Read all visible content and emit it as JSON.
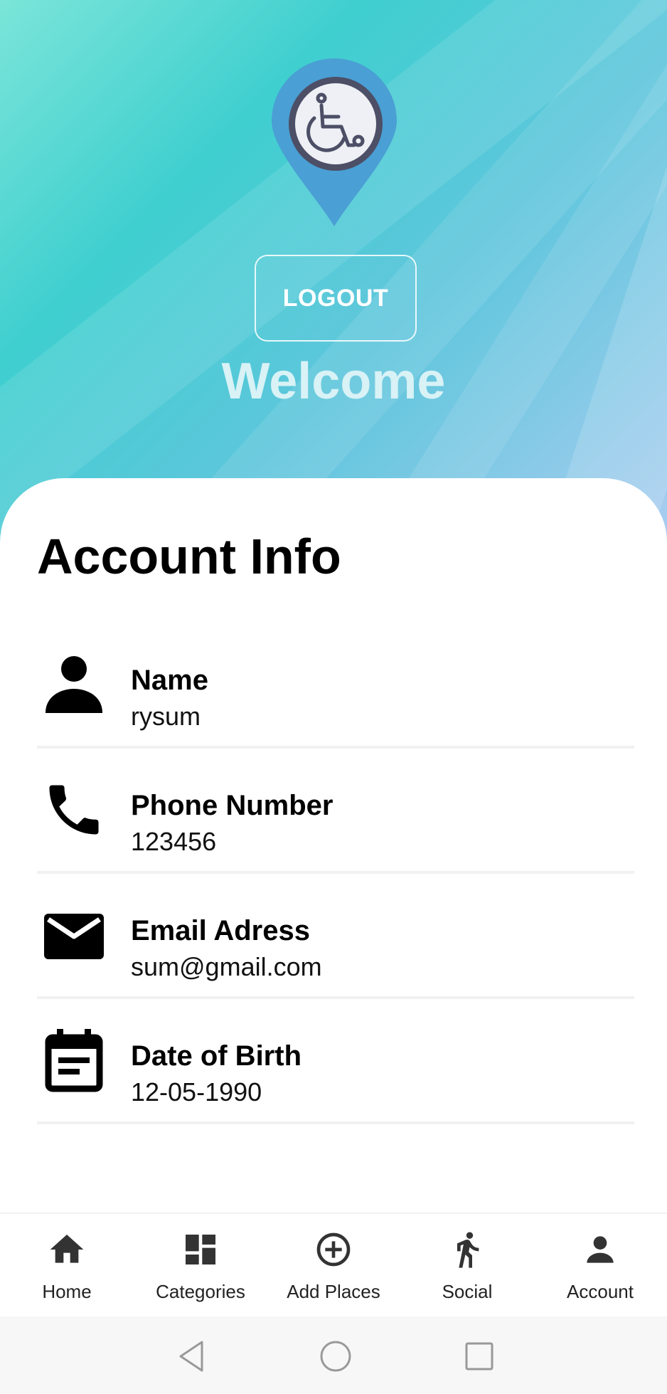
{
  "header": {
    "logout_label": "LOGOUT",
    "welcome_text": "Welcome",
    "logo_icon": "wheelchair-location-pin-icon",
    "colors": {
      "gradient_start": "#7be5d9",
      "gradient_end": "#a9cdf0",
      "pin": "#4a9fd4"
    }
  },
  "account": {
    "title": "Account Info",
    "fields": [
      {
        "label": "Name",
        "value": "rysum",
        "icon": "person-icon"
      },
      {
        "label": "Phone Number",
        "value": "123456",
        "icon": "phone-icon"
      },
      {
        "label": "Email Adress",
        "value": "sum@gmail.com",
        "icon": "email-icon"
      },
      {
        "label": "Date of Birth",
        "value": "12-05-1990",
        "icon": "calendar-icon"
      }
    ]
  },
  "bottom_nav": {
    "items": [
      {
        "label": "Home",
        "icon": "home-icon"
      },
      {
        "label": "Categories",
        "icon": "categories-icon"
      },
      {
        "label": "Add Places",
        "icon": "add-circle-icon"
      },
      {
        "label": "Social",
        "icon": "walking-person-icon"
      },
      {
        "label": "Account",
        "icon": "account-icon"
      }
    ]
  },
  "system_nav": {
    "icons": [
      "back-icon",
      "home-circle-icon",
      "recents-icon"
    ]
  }
}
